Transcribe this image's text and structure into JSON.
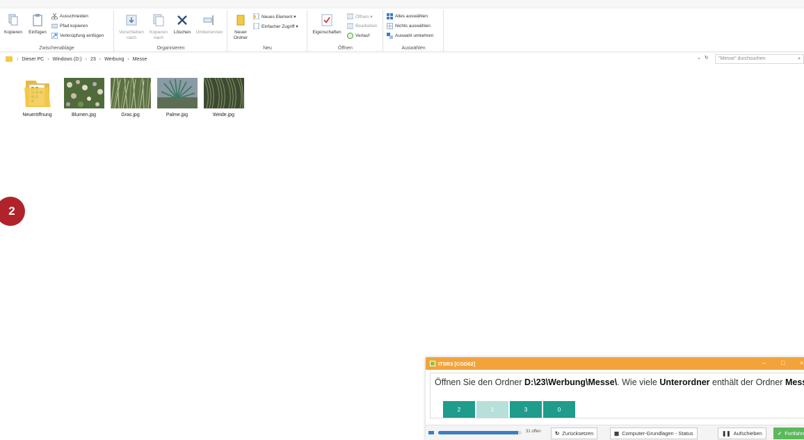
{
  "ribbon": {
    "clipboard": {
      "title": "Zwischenablage",
      "copy": "Kopieren",
      "paste": "Einfügen",
      "cut": "Ausschneiden",
      "copy_path": "Pfad kopieren",
      "paste_shortcut": "Verknüpfung einfügen"
    },
    "organize": {
      "title": "Organisieren",
      "move_to": "Verschieben nach",
      "copy_to": "Kopieren nach",
      "delete": "Löschen",
      "rename": "Umbenennen"
    },
    "new": {
      "title": "Neu",
      "new_folder": "Neuer Ordner",
      "new_item": "Neues Element ▾",
      "easy_access": "Einfacher Zugriff ▾"
    },
    "open": {
      "title": "Öffnen",
      "properties": "Eigenschaften",
      "open": "Öffnen ▾",
      "edit": "Bearbeiten",
      "history": "Verlauf"
    },
    "select": {
      "title": "Auswählen",
      "select_all": "Alles auswählen",
      "select_none": "Nichts auswählen",
      "invert": "Auswahl umkehren"
    }
  },
  "address": {
    "crumbs": [
      "Dieser PC",
      "Windows (D:)",
      "23",
      "Werbung",
      "Messe"
    ],
    "search_placeholder": "\"Messe\" durchsuchen"
  },
  "files": [
    {
      "name": "Neueröffnung",
      "kind": "folder"
    },
    {
      "name": "Blumen.jpg",
      "kind": "image-flowers"
    },
    {
      "name": "Gras.jpg",
      "kind": "image-grass"
    },
    {
      "name": "Palme.jpg",
      "kind": "image-palm"
    },
    {
      "name": "Weide.jpg",
      "kind": "image-willow"
    }
  ],
  "step_badge": "2",
  "dialog": {
    "title": "ITSR3 [CGD62]",
    "question_pre": "Öffnen Sie den Ordner ",
    "question_path": "D:\\23\\Werbung\\Messe\\",
    "question_mid": ". Wie viele ",
    "question_bold": "Unterordner",
    "question_mid2": " enthält der Ordner ",
    "question_folder": "Messe",
    "question_end": "?",
    "answers": [
      "2",
      "1",
      "3",
      "0"
    ],
    "progress_fraction": 0.96,
    "open_count": "31 offen",
    "reset": "Zurücksetzen",
    "status": "Computer-Grundlagen - Status",
    "postpone": "Aufschieben",
    "next": "Fortfahren"
  },
  "colors": {
    "accent_orange": "#f2a43a",
    "answer_teal": "#1f9c8c",
    "badge_red": "#b0232a"
  }
}
